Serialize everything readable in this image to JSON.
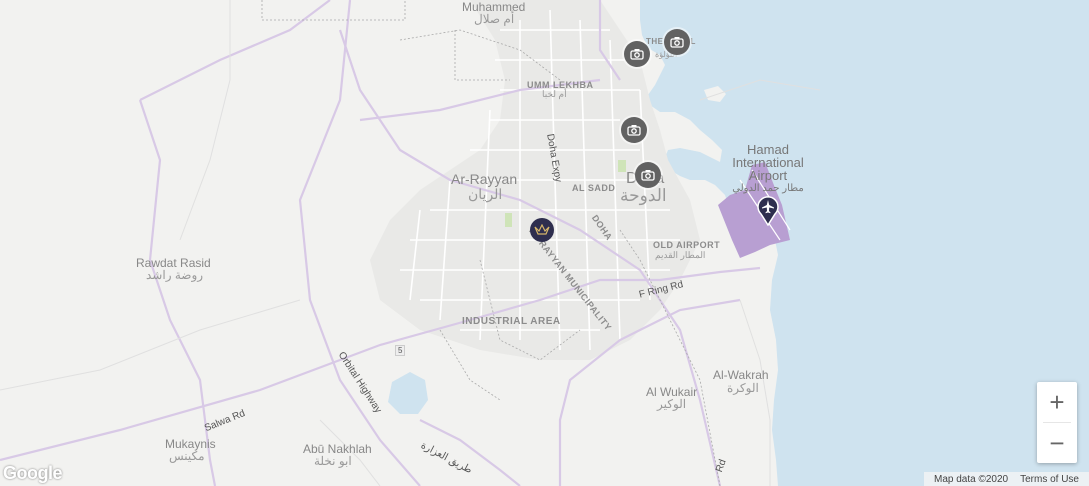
{
  "labels": {
    "muhammed": "Muhammed",
    "muhammed_ar": "أم صلال",
    "umm_lekhba": "UMM LEKHBA",
    "umm_lekhba_ar": "أم لخبا",
    "ar_rayyan": "Ar-Rayyan",
    "ar_rayyan_ar": "الريان",
    "doha": "Doha",
    "doha_ar": "الدوحة",
    "al_sadd": "AL SADD",
    "al_rayyan_municipality": "AL RAYYAN MUNICIPALITY",
    "doha_district": "DOHA",
    "old_airport": "OLD AIRPORT",
    "old_airport_ar": "المطار القديم",
    "industrial_area": "INDUSTRIAL AREA",
    "rawdat_rasid": "Rawdat Rasid",
    "rawdat_rasid_ar": "روضة راشد",
    "al_wukair": "Al Wukair",
    "al_wukair_ar": "الوكير",
    "al_wakrah": "Al-Wakrah",
    "al_wakrah_ar": "الوكرة",
    "mukaynis": "Mukaynis",
    "mukaynis_ar": "مكينس",
    "abu_nakhlah": "Abū Nakhlah",
    "abu_nakhlah_ar": "ابو نخلة",
    "airport_line1": "Hamad",
    "airport_line2": "International",
    "airport_line3": "Airport",
    "airport_ar": "مطار حمد الدولي",
    "the_pearl": "THE PEARL",
    "the_pearl_ar": "اللؤلؤة"
  },
  "roads": {
    "doha_expy": "Doha Expy",
    "f_ring_rd": "F Ring Rd",
    "salwa_rd": "Salwa Rd",
    "orbital_highway": "Orbital Highway",
    "al_karana": "طريق العزارة",
    "route_5": "5",
    "rd_fragment": "Rd"
  },
  "markers": {
    "photo_pin_1": "camera-icon",
    "photo_pin_2": "camera-icon",
    "photo_pin_3": "camera-icon",
    "photo_pin_4": "camera-icon",
    "hotel_pin": "crown-icon",
    "airport_pin": "plane-icon"
  },
  "controls": {
    "zoom_in": "+",
    "zoom_out": "−"
  },
  "footer": {
    "map_data": "Map data ©2020",
    "terms": "Terms of Use"
  },
  "brand": {
    "logo": "Google"
  },
  "colors": {
    "land": "#f2f2f0",
    "water": "#cfe3ef",
    "urban": "#e8e8e6",
    "highway": "#d9c8e6",
    "airport": "#b59bd0"
  }
}
